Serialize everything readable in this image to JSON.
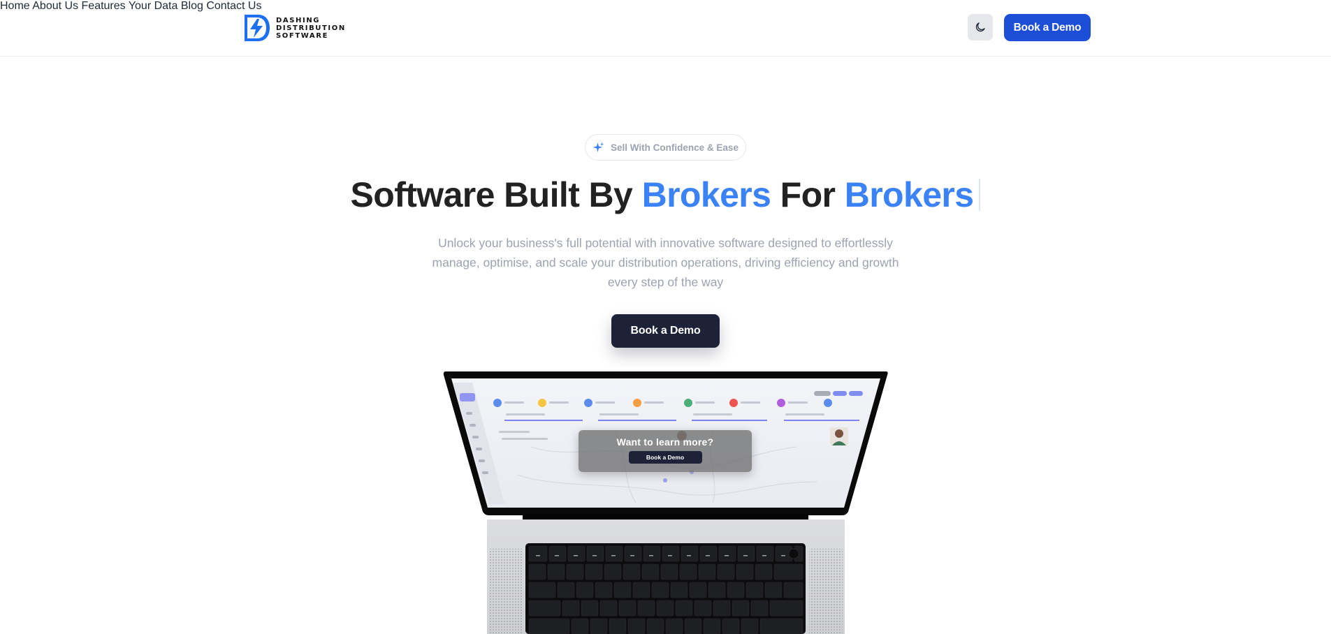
{
  "brand": {
    "line1": "DASHING",
    "line2": "DISTRIBUTION",
    "line3": "SOFTWARE",
    "color": "#1d6ff2"
  },
  "nav": {
    "items": [
      "Home",
      "About Us",
      "Features",
      "Your Data",
      "Blog",
      "Contact Us"
    ],
    "theme_toggle_icon": "moon-icon",
    "cta_label": "Book a Demo"
  },
  "hero": {
    "badge": "Sell With Confidence & Ease",
    "badge_icon": "sparkle-icon",
    "headline_part1": "Software Built By ",
    "headline_highlight1": "Brokers",
    "headline_part2": " For ",
    "headline_highlight2": "Brokers",
    "subtitle": "Unlock your business's full potential with innovative software designed to effortlessly manage, optimise, and scale your distribution operations, driving efficiency and growth every step of the way",
    "cta_label": "Book a Demo"
  },
  "laptop_screen": {
    "overlay_title": "Want to learn more?",
    "overlay_button": "Book a Demo"
  },
  "colors": {
    "accent_blue": "#3b82f6",
    "button_blue": "#1d4ed8",
    "dark_button": "#1e2238"
  }
}
